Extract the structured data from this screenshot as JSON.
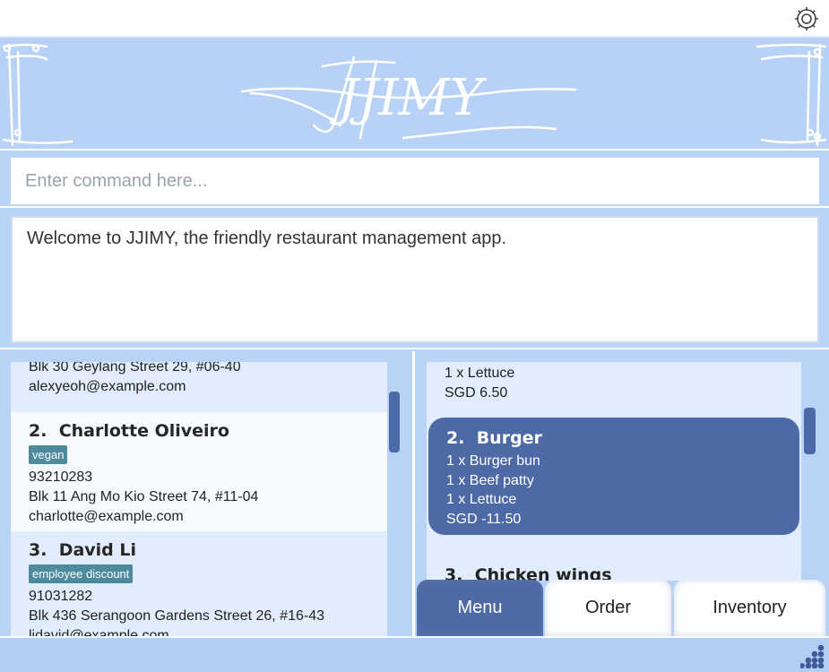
{
  "header": {
    "settings_icon": "gear-icon"
  },
  "banner": {
    "logo_text": "JJIMY"
  },
  "command": {
    "placeholder": "Enter command here...",
    "value": ""
  },
  "result": {
    "message": "Welcome to JJIMY, the friendly restaurant management app."
  },
  "customers": [
    {
      "partial": true,
      "address": "Blk 30 Geylang Street 29, #06-40",
      "email": "alexyeoh@example.com"
    },
    {
      "index": "2.",
      "name": "Charlotte Oliveiro",
      "tags": [
        "vegan"
      ],
      "phone": "93210283",
      "address": "Blk 11 Ang Mo Kio Street 74, #11-04",
      "email": "charlotte@example.com"
    },
    {
      "index": "3.",
      "name": "David Li",
      "tags": [
        "employee discount"
      ],
      "phone": "91031282",
      "address": "Blk 436 Serangoon Gardens Street 26, #16-43",
      "email": "lidavid@example.com"
    }
  ],
  "menu_items": [
    {
      "partial": true,
      "lines": [
        "1 x Lettuce",
        "SGD 6.50"
      ]
    },
    {
      "index": "2.",
      "name": "Burger",
      "lines": [
        "1 x Burger bun",
        "1 x Beef patty",
        "1 x Lettuce",
        "SGD -11.50"
      ],
      "selected": true
    },
    {
      "index": "3.",
      "name": "Chicken wings"
    }
  ],
  "tabs": [
    {
      "label": "Menu",
      "active": true
    },
    {
      "label": "Order",
      "active": false
    },
    {
      "label": "Inventory",
      "active": false
    }
  ],
  "colors": {
    "background": "#b9d3f7",
    "accent": "#4e6aa6",
    "tag": "#4e8a9d"
  }
}
